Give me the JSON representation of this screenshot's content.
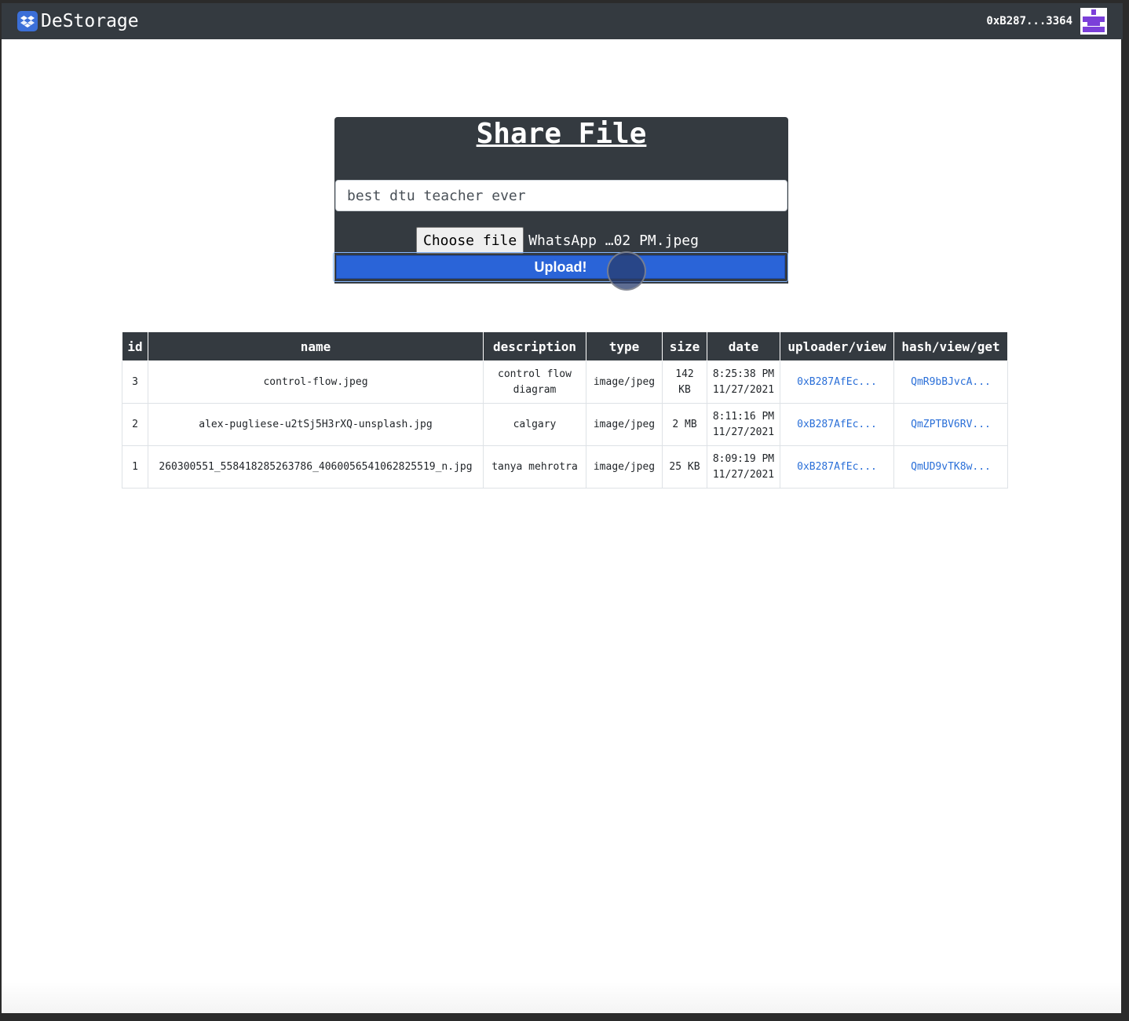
{
  "navbar": {
    "brand_name": "DeStorage",
    "account_address": "0xB287...3364"
  },
  "share": {
    "title": "Share File",
    "description_value": "best dtu teacher ever",
    "choose_file_label": "Choose file",
    "selected_file_name": "WhatsApp …02 PM.jpeg",
    "upload_label": "Upload!"
  },
  "files_table": {
    "headers": {
      "id": "id",
      "name": "name",
      "description": "description",
      "type": "type",
      "size": "size",
      "date": "date",
      "uploader": "uploader/view",
      "hash": "hash/view/get"
    },
    "rows": [
      {
        "id": "3",
        "name": "control-flow.jpeg",
        "description": "control flow diagram",
        "type": "image/jpeg",
        "size": "142 KB",
        "time": "8:25:38 PM",
        "date": "11/27/2021",
        "uploader": "0xB287AfEc...",
        "hash": "QmR9bBJvcA..."
      },
      {
        "id": "2",
        "name": "alex-pugliese-u2tSj5H3rXQ-unsplash.jpg",
        "description": "calgary",
        "type": "image/jpeg",
        "size": "2 MB",
        "time": "8:11:16 PM",
        "date": "11/27/2021",
        "uploader": "0xB287AfEc...",
        "hash": "QmZPTBV6RV..."
      },
      {
        "id": "1",
        "name": "260300551_558418285263786_4060056541062825519_n.jpg",
        "description": "tanya mehrotra",
        "type": "image/jpeg",
        "size": "25 KB",
        "time": "8:09:19 PM",
        "date": "11/27/2021",
        "uploader": "0xB287AfEc...",
        "hash": "QmUD9vTK8w..."
      }
    ]
  },
  "colors": {
    "navbar_bg": "#343a40",
    "upload_button": "#2a64d8",
    "link": "#2a6fd8",
    "identicon": "#7b3fd9"
  }
}
